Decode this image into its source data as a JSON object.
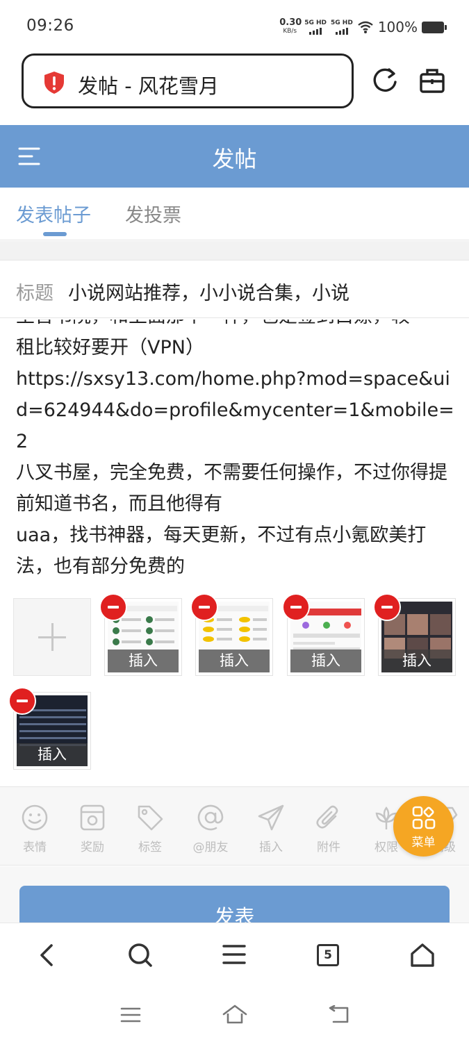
{
  "status_bar": {
    "time": "09:26",
    "net_speed": "0.30",
    "net_unit": "KB/s",
    "signal1": "5G HD",
    "signal2": "5G HD",
    "battery": "100%"
  },
  "browser": {
    "url_title": "发帖 - 风花雪月",
    "icons": [
      "shield-alert-icon",
      "reload-icon",
      "toolbox-icon"
    ]
  },
  "header": {
    "title": "发帖",
    "menu_icon": "hamburger-icon"
  },
  "tabs": [
    {
      "label": "发表帖子",
      "active": true
    },
    {
      "label": "发投票",
      "active": false
    }
  ],
  "post": {
    "title_label": "标题",
    "title_value": "小说网站推荐，小小说合集，小说",
    "content_lines": [
      "王晋书院，和上面那个一样，也是签到白嫖，较",
      "租比较好要开（VPN）",
      "https://sxsy13.com/home.php?mod=space&uid=624944&do=profile&mycenter=1&mobile=2",
      "八叉书屋，完全免费，不需要任何操作，不过你得提前知道书名，而且他得有",
      "uaa，找书神器，每天更新，不过有点小氪欧美打法，也有部分免费的"
    ]
  },
  "attachments": {
    "insert_label": "插入",
    "count": 6
  },
  "toolbar": {
    "items": [
      {
        "label": "表情",
        "icon": "smiley-icon"
      },
      {
        "label": "奖励",
        "icon": "reward-icon"
      },
      {
        "label": "标签",
        "icon": "tag-icon"
      },
      {
        "label": "@朋友",
        "icon": "at-icon"
      },
      {
        "label": "插入",
        "icon": "send-icon"
      },
      {
        "label": "附件",
        "icon": "paperclip-icon"
      },
      {
        "label": "权限",
        "icon": "flower-icon"
      },
      {
        "label": "高级",
        "icon": "diamond-icon"
      }
    ],
    "fab_label": "菜单"
  },
  "publish_label": "发表",
  "bottom_nav": {
    "tab_count": "5"
  },
  "colors": {
    "accent": "#6b9bd2",
    "fab": "#f5a623",
    "remove": "#e02020"
  }
}
